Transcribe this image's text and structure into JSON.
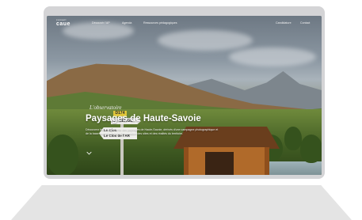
{
  "site": {
    "logo_small": "conseil",
    "logo": "caue"
  },
  "nav": {
    "left_links": [
      "Découvrir l'AP",
      "Agenda",
      "Ressources pédagogiques"
    ],
    "right_links": [
      "Candidature",
      "Contact"
    ]
  },
  "hero": {
    "kicker": "L'observatoire",
    "title": "Paysages de Haute-Savoie",
    "description": "Découvrez les changements des paysages de Haute-Savoie, dérivés d'une campagne photographique et de la base multiples depuis l'observation des sites et des réalités du territoire."
  },
  "signs": {
    "yellow": "D174",
    "white1": "LE NERGE",
    "white2_line1": "Le Clos",
    "white2_line2": "Le Clos de l'AR"
  },
  "icons": {
    "scroll": "chevron-down-icon"
  }
}
